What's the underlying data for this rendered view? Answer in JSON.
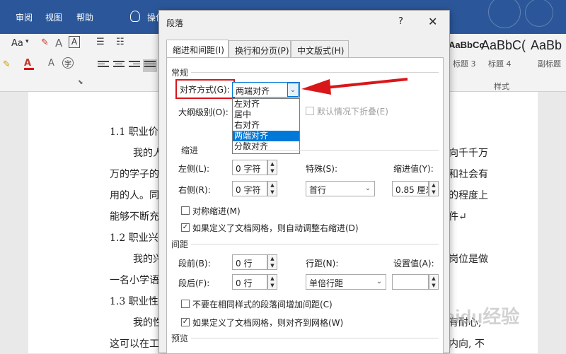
{
  "ribbon": {
    "tabs": [
      "审阅",
      "视图",
      "帮助"
    ],
    "tell_me": "操作",
    "styles": [
      {
        "preview": "AaBbCc",
        "label": "标题 3"
      },
      {
        "preview": "AaBbC(",
        "label": "标题 4"
      },
      {
        "preview": "AaBb",
        "label": "副标题"
      }
    ],
    "styles_group_label": "样式",
    "font_size_btn": "Aa",
    "font_color_letter": "A"
  },
  "document": {
    "lines": [
      "1.1 职业价",
      "我的人",
      "万的学子的",
      "用的人。同",
      "能够不断充",
      "1.2 职业兴",
      "我的兴",
      "一名小学语",
      "1.3 职业性",
      "我的性",
      "这可以在工"
    ],
    "right_fragments": [
      "向千千万",
      "和社会有",
      "的程度上",
      "件↵",
      "岗位是做",
      "有耐心,",
      "内向, 不"
    ],
    "watermark": "Baidu经验"
  },
  "dialog": {
    "title": "段落",
    "help": "?",
    "close": "✕",
    "tabs": [
      "缩进和间距(I)",
      "换行和分页(P)",
      "中文版式(H)"
    ],
    "general": {
      "section": "常规",
      "alignment_label": "对齐方式(G):",
      "alignment_value": "两端对齐",
      "alignment_options": [
        "左对齐",
        "居中",
        "右对齐",
        "两端对齐",
        "分散对齐"
      ],
      "outline_label": "大纲级别(O):",
      "collapse_label": "默认情况下折叠(E)"
    },
    "indent": {
      "section": "缩进",
      "left_label": "左侧(L):",
      "left_value": "0 字符",
      "right_label": "右侧(R):",
      "right_value": "0 字符",
      "special_label": "特殊(S):",
      "special_value": "首行",
      "by_label": "缩进值(Y):",
      "by_value": "0.85 厘米",
      "mirror_label": "对称缩进(M)",
      "auto_adjust_label": "如果定义了文档网格，则自动调整右缩进(D)"
    },
    "spacing": {
      "section": "间距",
      "before_label": "段前(B):",
      "before_value": "0 行",
      "after_label": "段后(F):",
      "after_value": "0 行",
      "line_label": "行距(N):",
      "line_value": "单倍行距",
      "at_label": "设置值(A):",
      "at_value": "",
      "no_space_label": "不要在相同样式的段落间增加间距(C)",
      "snap_grid_label": "如果定义了文档网格，则对齐到网格(W)"
    },
    "preview_label": "预览"
  },
  "colors": {
    "ribbon_blue": "#2b579a",
    "annotation_red": "#d9161a",
    "selection_blue": "#0078d7"
  }
}
